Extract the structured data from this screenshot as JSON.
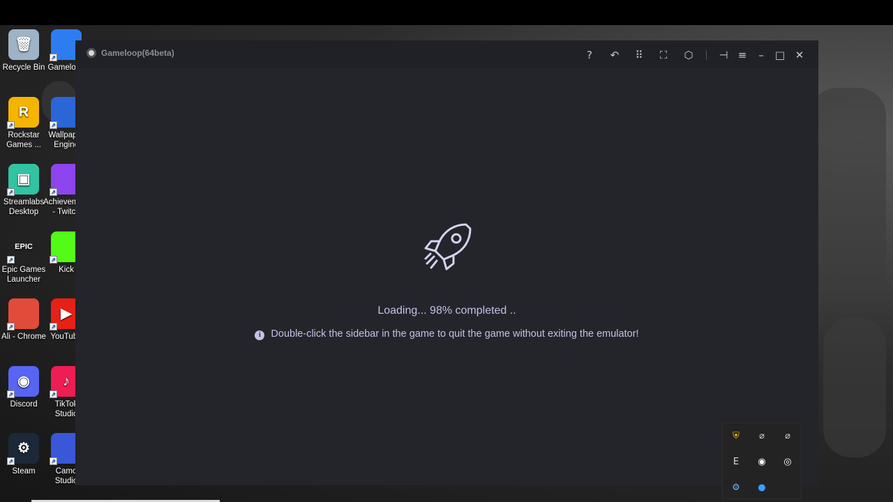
{
  "desktop": {
    "icons": [
      {
        "label": "Recycle Bin",
        "glyph": "🗑",
        "color": "#9fb3c6",
        "icon": "recycle-bin-icon"
      },
      {
        "label": "Gameloop",
        "glyph": "",
        "color": "#2d7cf0",
        "icon": "gameloop-icon"
      },
      {
        "label": "Rockstar\nGames ...",
        "glyph": "R",
        "color": "#f4b400",
        "icon": "rockstar-icon"
      },
      {
        "label": "Wallpaper\nEngine",
        "glyph": "",
        "color": "#2a66d6",
        "icon": "wallpaper-engine-icon"
      },
      {
        "label": "Streamlabs\nDesktop",
        "glyph": "▣",
        "color": "#31c3a2",
        "icon": "streamlabs-icon"
      },
      {
        "label": "Achievements\n- Twitch",
        "glyph": "",
        "color": "#8e44ef",
        "icon": "twitch-icon"
      },
      {
        "label": "Epic Games\nLauncher",
        "glyph": "EPIC",
        "color": "#222222",
        "icon": "epic-games-icon"
      },
      {
        "label": "Kick",
        "glyph": "",
        "color": "#53fc18",
        "icon": "kick-icon"
      },
      {
        "label": "Ali - Chrome",
        "glyph": "",
        "color": "#e04b3a",
        "icon": "chrome-icon"
      },
      {
        "label": "YouTube",
        "glyph": "▶",
        "color": "#e62117",
        "icon": "youtube-icon"
      },
      {
        "label": "Discord",
        "glyph": "◉",
        "color": "#5865f2",
        "icon": "discord-icon"
      },
      {
        "label": "TikTok\nStudio",
        "glyph": "♪",
        "color": "#ee1d52",
        "icon": "tiktok-icon"
      },
      {
        "label": "Steam",
        "glyph": "⚙",
        "color": "#1b2838",
        "icon": "steam-icon"
      },
      {
        "label": "Camo Studio",
        "glyph": "",
        "color": "#3a57d8",
        "icon": "camo-icon"
      }
    ]
  },
  "window": {
    "title": "Gameloop(64beta)",
    "toolbar": [
      {
        "name": "help-icon",
        "glyph": "?"
      },
      {
        "name": "undo-icon",
        "glyph": "↶"
      },
      {
        "name": "keyboard-icon",
        "glyph": "⠿"
      },
      {
        "name": "fullscreen-icon",
        "glyph": "⛶"
      },
      {
        "name": "settings-cube-icon",
        "glyph": "⬡"
      },
      {
        "name": "pin-icon",
        "glyph": "⊣"
      },
      {
        "name": "menu-icon",
        "glyph": "≡"
      },
      {
        "name": "minimize-icon",
        "glyph": "–"
      },
      {
        "name": "maximize-icon",
        "glyph": "□"
      },
      {
        "name": "close-icon",
        "glyph": "✕"
      }
    ]
  },
  "loading": {
    "text": "Loading... 98% completed ..",
    "percent": 98,
    "tip_icon": "i",
    "tip": "Double-click the sidebar in the game to quit the game without exiting the emulator!"
  },
  "tray": {
    "icons": [
      {
        "name": "windows-security-icon",
        "glyph": "⛨",
        "color": "#f2c200"
      },
      {
        "name": "network-off-icon",
        "glyph": "⌀",
        "color": "#cccccc"
      },
      {
        "name": "network-off-2-icon",
        "glyph": "⌀",
        "color": "#cccccc"
      },
      {
        "name": "epic-tray-icon",
        "glyph": "E",
        "color": "#dddddd"
      },
      {
        "name": "discord-tray-icon",
        "glyph": "◉",
        "color": "#ffffff"
      },
      {
        "name": "headset-tray-icon",
        "glyph": "◎",
        "color": "#ffffff"
      },
      {
        "name": "steam-tray-icon",
        "glyph": "⚙",
        "color": "#66b3ff"
      },
      {
        "name": "gameloop-tray-icon",
        "glyph": "●",
        "color": "#3aa0ff"
      }
    ]
  }
}
